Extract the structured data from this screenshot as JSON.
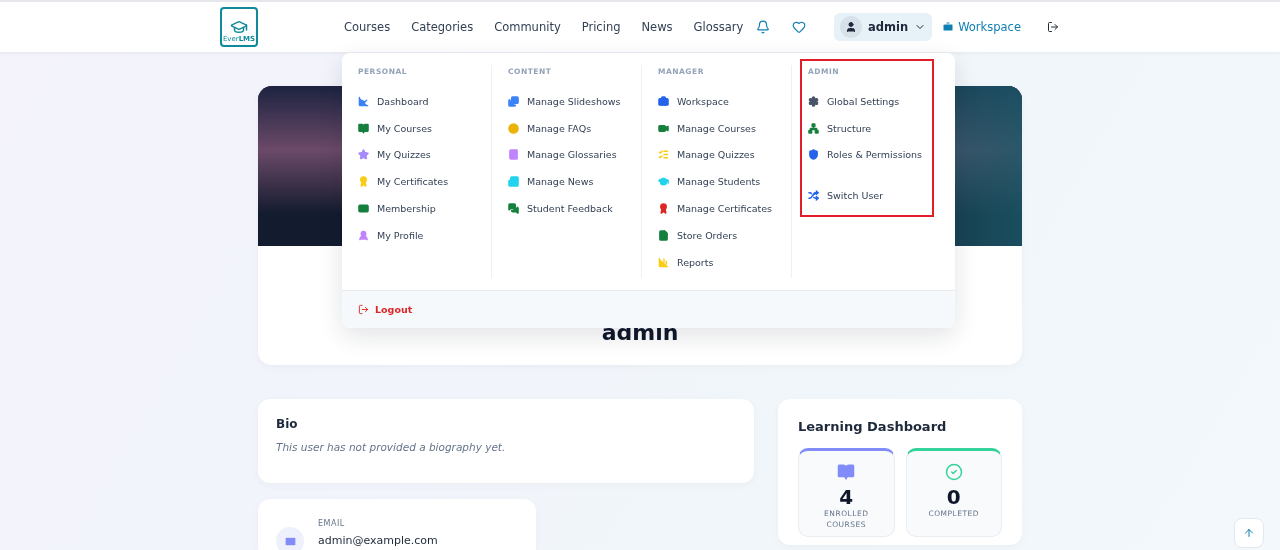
{
  "header": {
    "logo": {
      "text_top": "Ever",
      "text_bold": "LMS"
    },
    "nav": [
      "Courses",
      "Categories",
      "Community",
      "Pricing",
      "News",
      "Glossary"
    ],
    "user": {
      "name": "admin",
      "expanded": true
    },
    "workspace_link": "Workspace"
  },
  "dropdown": {
    "sections": [
      {
        "title": "PERSONAL",
        "highlighted": false,
        "items": [
          {
            "label": "Dashboard",
            "color": "#3b82f6"
          },
          {
            "label": "My Courses",
            "color": "#15803d"
          },
          {
            "label": "My Quizzes",
            "color": "#a78bfa"
          },
          {
            "label": "My Certificates",
            "color": "#facc15"
          },
          {
            "label": "Membership",
            "color": "#15803d"
          },
          {
            "label": "My Profile",
            "color": "#c084fc"
          }
        ]
      },
      {
        "title": "CONTENT",
        "highlighted": false,
        "items": [
          {
            "label": "Manage Slideshows",
            "color": "#3b82f6"
          },
          {
            "label": "Manage FAQs",
            "color": "#eab308"
          },
          {
            "label": "Manage Glossaries",
            "color": "#c084fc"
          },
          {
            "label": "Manage News",
            "color": "#22d3ee"
          },
          {
            "label": "Student Feedback",
            "color": "#15803d"
          }
        ]
      },
      {
        "title": "MANAGER",
        "highlighted": false,
        "items": [
          {
            "label": "Workspace",
            "color": "#2563eb"
          },
          {
            "label": "Manage Courses",
            "color": "#15803d"
          },
          {
            "label": "Manage Quizzes",
            "color": "#facc15"
          },
          {
            "label": "Manage Students",
            "color": "#22d3ee"
          },
          {
            "label": "Manage Certificates",
            "color": "#dc2626"
          },
          {
            "label": "Store Orders",
            "color": "#15803d"
          },
          {
            "label": "Reports",
            "color": "#facc15"
          }
        ]
      },
      {
        "title": "ADMIN",
        "highlighted": true,
        "items": [
          {
            "label": "Global Settings",
            "color": "#475569"
          },
          {
            "label": "Structure",
            "color": "#15803d"
          },
          {
            "label": "Roles & Permissions",
            "color": "#2563eb"
          },
          {
            "label": "Switch User",
            "color": "#2563eb"
          }
        ]
      }
    ],
    "logout": "Logout"
  },
  "profile": {
    "name": "admin"
  },
  "bio": {
    "title": "Bio",
    "text": "This user has not provided a biography yet."
  },
  "contact": {
    "label": "EMAIL",
    "value": "admin@example.com"
  },
  "dashboard": {
    "title": "Learning Dashboard",
    "stats": [
      {
        "value": "4",
        "label": "ENROLLED COURSES",
        "color": "#818cf8"
      },
      {
        "value": "0",
        "label": "COMPLETED",
        "color": "#34d399"
      }
    ]
  }
}
